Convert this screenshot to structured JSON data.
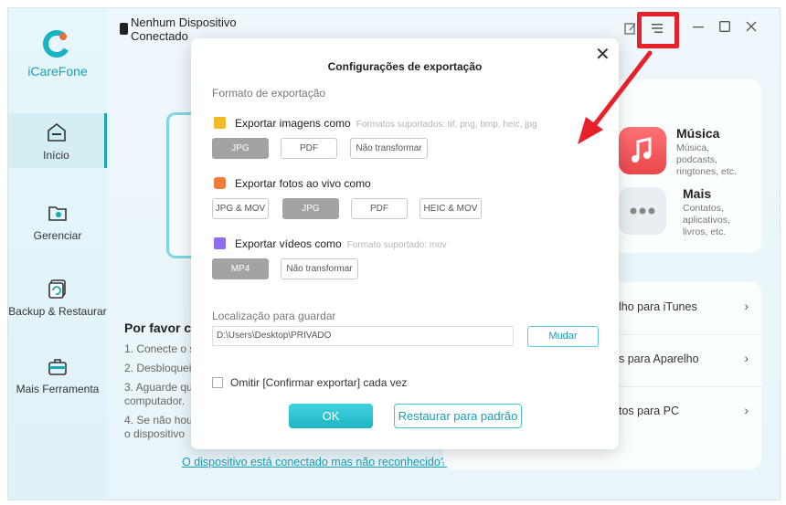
{
  "app": {
    "brand": "iCareFone"
  },
  "device": {
    "line1": "Nenhum Dispositivo",
    "line2": "Conectado"
  },
  "sidebar": {
    "items": [
      {
        "label": "Início",
        "icon": "home-icon",
        "active": true
      },
      {
        "label": "Gerenciar",
        "icon": "folder-gear-icon",
        "active": false
      },
      {
        "label": "Backup & Restaurar",
        "icon": "backup-icon",
        "active": false
      },
      {
        "label": "Mais Ferramenta",
        "icon": "toolbox-icon",
        "active": false
      }
    ]
  },
  "main": {
    "instructions_title": "Por favor co",
    "steps": [
      "1. Conecte o se",
      "2. Desbloquei",
      "3. Aguarde qu",
      "computador.",
      "4. Se não houv",
      "o dispositivo"
    ],
    "footer_link": "O dispositivo está conectado mas não reconhecido?"
  },
  "right_panel": {
    "music": {
      "title": "Música",
      "desc": [
        "Música,",
        "podcasts,",
        "ringtones, etc."
      ]
    },
    "more": {
      "title": "Mais",
      "desc": [
        "Contatos,",
        "aplicativos,",
        "livros, etc."
      ]
    },
    "rows": [
      "lho para iTunes",
      "s para Aparelho",
      "tos para PC"
    ]
  },
  "dialog": {
    "title": "Configurações de exportação",
    "format_label": "Formato de exportação",
    "images": {
      "label": "Exportar imagens como",
      "hint": "Formatos suportados: tif, png, bmp, heic, jpg",
      "options": [
        "JPG",
        "PDF",
        "Não transformar"
      ],
      "selected": "JPG"
    },
    "live": {
      "label": "Exportar fotos ao vivo como",
      "options": [
        "JPG & MOV",
        "JPG",
        "PDF",
        "HEIC & MOV"
      ],
      "selected": "JPG"
    },
    "videos": {
      "label": "Exportar vídeos como",
      "hint": "Formato suportado: mov",
      "options": [
        "MP4",
        "Não transformar"
      ],
      "selected": "MP4"
    },
    "location_label": "Localização para guardar",
    "path_value": "D:\\Users\\Desktop\\PRIVADO",
    "change_button": "Mudar",
    "skip_confirm": "Omitir [Confirmar exportar] cada vez",
    "ok_button": "OK",
    "reset_button": "Restaurar para padrão"
  },
  "colors": {
    "accent": "#1fb5c4",
    "highlight": "#e8202a",
    "music": "#f0585c"
  }
}
